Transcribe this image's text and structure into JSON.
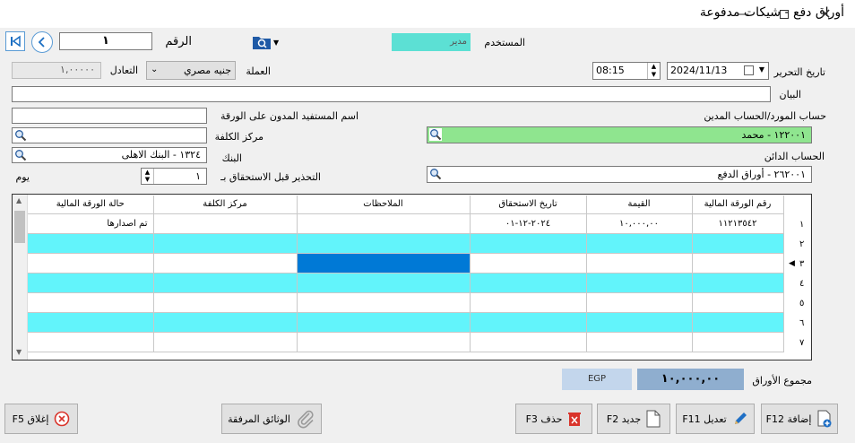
{
  "window": {
    "title": "أوراق دفع - شيكات مدفوعة"
  },
  "header": {
    "number_label": "الرقم",
    "number_value": "١",
    "user_label": "المستخدم",
    "user_value": "مدير",
    "date_label": "تاريخ التحرير",
    "date_value": "2024/11/13",
    "time_value": "08:15",
    "currency_label": "العملة",
    "currency_value": "جنيه مصري",
    "rate_label": "التعادل",
    "rate_value": "١,٠٠٠٠٠"
  },
  "form": {
    "statement_label": "البيان",
    "statement_value": "",
    "beneficiary_label": "اسم المستفيد المدون على الورقة",
    "beneficiary_value": "",
    "supplier_label": "حساب المورد/الحساب المدين",
    "supplier_value": "١٢٢٠٠١ - محمد",
    "cost_center_label": "مركز الكلفة",
    "cost_center_value": "",
    "bank_label": "البنك",
    "bank_value": "١٣٢٤ - البنك الاهلى",
    "credit_label": "الحساب الدائن",
    "credit_value": "٢٦٢٠٠١ - أوراق الدفع",
    "warn_label": "التحذير قبل الاستحقاق بـ",
    "warn_value": "١",
    "warn_unit": "يوم"
  },
  "grid": {
    "columns": [
      "رقم الورقة المالية",
      "القيمة",
      "تاريخ الاستحقاق",
      "الملاحظات",
      "مركز الكلفة",
      "حالة الورقة المالية"
    ],
    "rows": [
      {
        "n": "١",
        "cells": [
          "١١٢١٣٥٤٢",
          "١٠,٠٠٠,٠٠",
          "٢٠٢٤-١٢-٠١",
          "",
          "",
          "تم اصدارها"
        ]
      },
      {
        "n": "٢",
        "cells": [
          "",
          "",
          "",
          "",
          "",
          ""
        ]
      },
      {
        "n": "٣",
        "cells": [
          "",
          "",
          "",
          "",
          "",
          ""
        ]
      },
      {
        "n": "٤",
        "cells": [
          "",
          "",
          "",
          "",
          "",
          ""
        ]
      },
      {
        "n": "٥",
        "cells": [
          "",
          "",
          "",
          "",
          "",
          ""
        ]
      },
      {
        "n": "٦",
        "cells": [
          "",
          "",
          "",
          "",
          "",
          ""
        ]
      },
      {
        "n": "٧",
        "cells": [
          "",
          "",
          "",
          "",
          "",
          ""
        ]
      }
    ]
  },
  "totals": {
    "label": "مجموع الأوراق",
    "value": "١٠,٠٠٠,٠٠",
    "currency": "EGP"
  },
  "buttons": {
    "add": "إضافة F12",
    "edit": "تعديل F11",
    "new": "جديد F2",
    "delete": "حذف F3",
    "attachments": "الوثائق المرفقة",
    "close": "إغلاق F5"
  },
  "colors": {
    "user_badge": "#5ce0d4",
    "supplier_field": "#8fe58f",
    "grid_row": "#62f4fb",
    "selected_cell": "#0079d6"
  }
}
